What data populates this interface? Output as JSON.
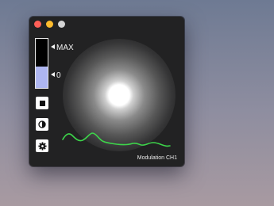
{
  "window": {
    "controls": [
      "close",
      "minimize",
      "zoom"
    ]
  },
  "meter": {
    "level": 0.43,
    "max_label": "MAX",
    "zero_label": "0",
    "fill_color": "#aeb6f0"
  },
  "buttons": {
    "stop": "stop-icon",
    "contrast": "contrast-icon",
    "settings": "gear-icon"
  },
  "visual": {
    "orb_color": "#ffffff",
    "wave_color": "#3dd44a"
  },
  "status": {
    "text": "Modulation CH1"
  }
}
